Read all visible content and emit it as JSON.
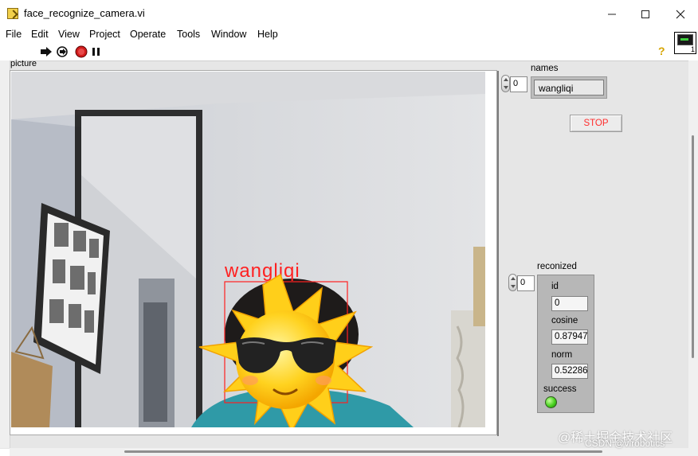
{
  "window": {
    "title": "face_recognize_camera.vi",
    "minimize_icon": "minimize-icon",
    "maximize_icon": "maximize-icon",
    "close_icon": "close-icon"
  },
  "menu": [
    "File",
    "Edit",
    "View",
    "Project",
    "Operate",
    "Tools",
    "Window",
    "Help"
  ],
  "toolbar": {
    "icons": [
      "run-arrow-icon",
      "run-continuously-icon",
      "abort-stop-icon",
      "pause-icon"
    ],
    "help_symbol": "?"
  },
  "vi_icon": {
    "number": "1"
  },
  "picture": {
    "label": "picture",
    "overlay_name": "wangliqi",
    "overlay_color": "#ff2020"
  },
  "names": {
    "label": "names",
    "index": "0",
    "value": "wangliqi"
  },
  "stop_button": {
    "label": "STOP",
    "text_color": "#ff2d2d"
  },
  "reconized": {
    "label": "reconized",
    "index": "0",
    "id_label": "id",
    "id_value": "0",
    "cosine_label": "cosine",
    "cosine_value": "0.87947",
    "norm_label": "norm",
    "norm_value": "0.52286",
    "success_label": "success",
    "success_state": "on",
    "led_color": "#47d11e"
  },
  "watermark": {
    "line1": "@稀土掘金技术社区",
    "line2": "CSDN @virobotics"
  }
}
